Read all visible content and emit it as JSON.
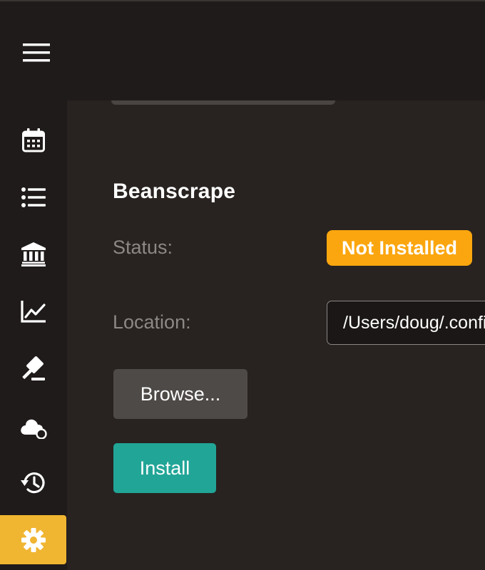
{
  "header": {
    "menu_icon": "hamburger-menu-icon"
  },
  "sidebar": {
    "items": [
      {
        "name": "calendar",
        "icon": "calendar-icon",
        "active": false
      },
      {
        "name": "list",
        "icon": "list-icon",
        "active": false
      },
      {
        "name": "bank",
        "icon": "bank-icon",
        "active": false
      },
      {
        "name": "chart",
        "icon": "line-chart-icon",
        "active": false
      },
      {
        "name": "auction",
        "icon": "gavel-icon",
        "active": false
      },
      {
        "name": "cloud-sync",
        "icon": "cloud-sync-icon",
        "active": false
      },
      {
        "name": "history",
        "icon": "history-icon",
        "active": false
      },
      {
        "name": "settings",
        "icon": "gear-icon",
        "active": true
      }
    ],
    "accent_color": "#f0b531"
  },
  "main": {
    "section_title": "Beanscrape",
    "status_label": "Status:",
    "status_value": "Not Installed",
    "status_color": "#fba60e",
    "location_label": "Location:",
    "location_value": "/Users/doug/.config",
    "browse_label": "Browse...",
    "install_label": "Install",
    "install_color": "#21a597"
  }
}
